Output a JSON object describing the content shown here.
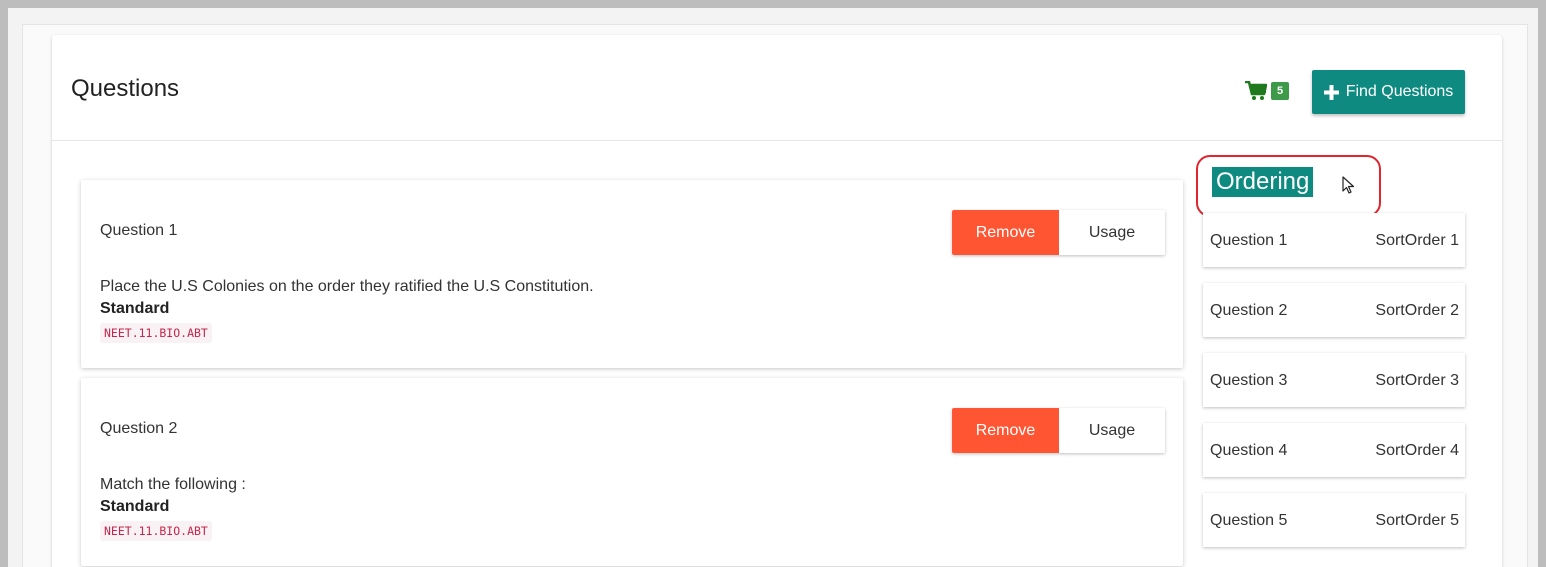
{
  "panel": {
    "title": "Questions",
    "cart_count": "5",
    "find_button_label": "Find Questions"
  },
  "questions": [
    {
      "title": "Question 1",
      "text": "Place the U.S Colonies on the order they ratified the U.S Constitution.",
      "standard_label": "Standard",
      "standard_code": "NEET.11.BIO.ABT",
      "remove_label": "Remove",
      "usage_label": "Usage"
    },
    {
      "title": "Question 2",
      "text": "Match the following :",
      "standard_label": "Standard",
      "standard_code": "NEET.11.BIO.ABT",
      "remove_label": "Remove",
      "usage_label": "Usage"
    }
  ],
  "ordering": {
    "title": "Ordering",
    "items": [
      {
        "question": "Question 1",
        "sort": "SortOrder 1"
      },
      {
        "question": "Question 2",
        "sort": "SortOrder 2"
      },
      {
        "question": "Question 3",
        "sort": "SortOrder 3"
      },
      {
        "question": "Question 4",
        "sort": "SortOrder 4"
      },
      {
        "question": "Question 5",
        "sort": "SortOrder 5"
      }
    ]
  },
  "colors": {
    "accent": "#0e8a80",
    "remove": "#ff5533",
    "cart": "#1f7a1f",
    "badge": "#3c9a48",
    "highlight_ring": "#e0252f"
  },
  "icons": {
    "cart": "cart-icon",
    "plus": "plus-icon",
    "cursor": "mouse-pointer-icon"
  }
}
